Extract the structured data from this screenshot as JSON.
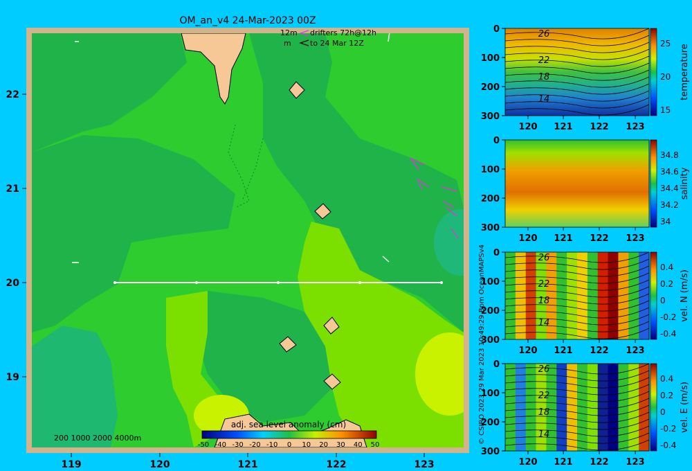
{
  "title": "OM_an_v4  24-Mar-2023 00Z",
  "legend": {
    "line1_depth": "12m",
    "line1_text": "drifters 72h@12h",
    "line2_depth": "m",
    "line2_text": "to 24 Mar 12Z"
  },
  "map": {
    "x_ticks": [
      "119",
      "120",
      "121",
      "122",
      "123"
    ],
    "y_ticks": [
      "22",
      "21",
      "20",
      "19"
    ],
    "bathy_label": "200  1000  2000  4000m",
    "colorbar_title": "adj. sea level anomaly (cm)",
    "colorbar_ticks": [
      "-50",
      "-40",
      "-30",
      "-20",
      "-10",
      "0",
      "10",
      "20",
      "30",
      "40",
      "50"
    ],
    "colors": {
      "sea_main": "#2ecc2e",
      "sea_dark": "#1fb34a",
      "sea_light": "#7be000",
      "sea_yellow": "#c8f200",
      "land": "#f6c896",
      "frame": "#d2b48c"
    }
  },
  "credit": "© CSIRO 2023   29 Mar 2023 10:49:29 Bpm OceanMAPSv4",
  "panels": [
    {
      "ylabel": "temperature",
      "yticks": [
        "0",
        "100",
        "200",
        "300"
      ],
      "xticks": [
        "120",
        "121",
        "122",
        "123"
      ],
      "cticks": [
        "25",
        "20",
        "15"
      ],
      "contours": [
        "26",
        "22",
        "18",
        "14"
      ]
    },
    {
      "ylabel": "salinity",
      "yticks": [
        "0",
        "100",
        "200",
        "300"
      ],
      "xticks": [
        "120",
        "121",
        "122",
        "123"
      ],
      "cticks": [
        "34.8",
        "34.6",
        "34.4",
        "34.2",
        "34"
      ],
      "contours": []
    },
    {
      "ylabel": "vel. N (m/s)",
      "yticks": [
        "0",
        "100",
        "200",
        "300"
      ],
      "xticks": [
        "120",
        "121",
        "122",
        "123"
      ],
      "cticks": [
        "0.4",
        "0.2",
        "0",
        "-0.2",
        "-0.4"
      ],
      "contours": [
        "26",
        "22",
        "18",
        "14"
      ]
    },
    {
      "ylabel": "vel. E (m/s)",
      "yticks": [
        "0",
        "100",
        "200",
        "300"
      ],
      "xticks": [
        "120",
        "121",
        "122",
        "123"
      ],
      "cticks": [
        "0.4",
        "0.2",
        "0",
        "-0.2",
        "-0.4"
      ],
      "contours": [
        "26",
        "22",
        "18",
        "14"
      ]
    }
  ]
}
